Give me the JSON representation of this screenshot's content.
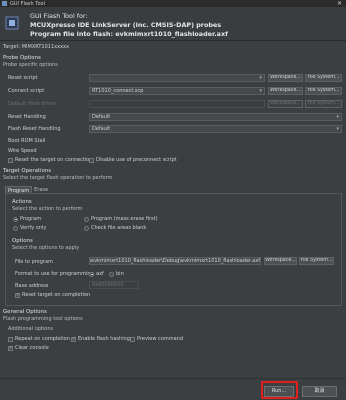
{
  "window": {
    "title": "GUI Flash Tool",
    "close_glyph": "✕"
  },
  "banner": {
    "line1": "GUI Flash Tool for:",
    "line2": "MCUXpresso IDE LinkServer (inc. CMSIS-DAP) probes",
    "line3": "Program file into flash: evkmimxrt1010_flashloader.axf"
  },
  "target": "Target: MIMXRT1011xxxxx",
  "probe_options": {
    "title": "Probe Options",
    "subtitle": "Probe specific options",
    "reset_script": {
      "label": "Reset script",
      "value": ""
    },
    "connect_script": {
      "label": "Connect script",
      "value": "RT1010_connect.scp"
    },
    "default_flash_driver": {
      "label": "Default flash driver",
      "value": ""
    },
    "reset_handling": {
      "label": "Reset Handling",
      "value": "Default"
    },
    "flash_reset_handling": {
      "label": "Flash Reset Handling",
      "value": "Default"
    },
    "boot_rom_stall": {
      "label": "Boot ROM Stall"
    },
    "wire_speed": {
      "label": "Wire Speed"
    },
    "workspace_label": "Workspace...",
    "filesystem_label": "File System...",
    "reset_on_connection": {
      "label": "Reset the target on connection",
      "checked": false
    },
    "disable_preconnect": {
      "label": "Disable use of preconnect script",
      "checked": false
    }
  },
  "target_operations": {
    "title": "Target Operations",
    "subtitle": "Select the target flash operation to perform",
    "tabs": [
      "Program",
      "Erase"
    ],
    "actions": {
      "title": "Actions",
      "subtitle": "Select the action to perform",
      "program": {
        "label": "Program",
        "selected": true
      },
      "program_mass_erase": {
        "label": "Program (mass erase first)",
        "selected": false
      },
      "verify_only": {
        "label": "Verify only",
        "selected": false
      },
      "check_blank": {
        "label": "Check file areas blank",
        "selected": false
      }
    },
    "options": {
      "title": "Options",
      "subtitle": "Select the options to apply",
      "file_label": "File to program",
      "file_value": "C:\\evkmimxrt1010_flashloader\\Debug\\evkmimxrt1010_flashloader.axf",
      "format_label": "Format to use for programming",
      "format_axf": {
        "label": "axf",
        "selected": true
      },
      "format_bin": {
        "label": "bin",
        "selected": false
      },
      "base_address_label": "Base address",
      "base_address_value": "0x60000000",
      "reset_on_completion": {
        "label": "Reset target on completion",
        "checked": true
      }
    }
  },
  "general_options": {
    "title": "General Options",
    "subtitle": "Flash programming tool options",
    "additional_title": "Additional options",
    "repeat_on_completion": {
      "label": "Repeat on completion",
      "checked": false
    },
    "enable_hashing": {
      "label": "Enable flash hashing",
      "checked": true
    },
    "preview_command": {
      "label": "Preview command",
      "checked": false
    },
    "clear_console": {
      "label": "Clear console",
      "checked": true
    }
  },
  "footer": {
    "run_label": "Run...",
    "cancel_label": "取消"
  },
  "colors": {
    "background": "#3c3f41",
    "highlight": "#e0201f"
  }
}
